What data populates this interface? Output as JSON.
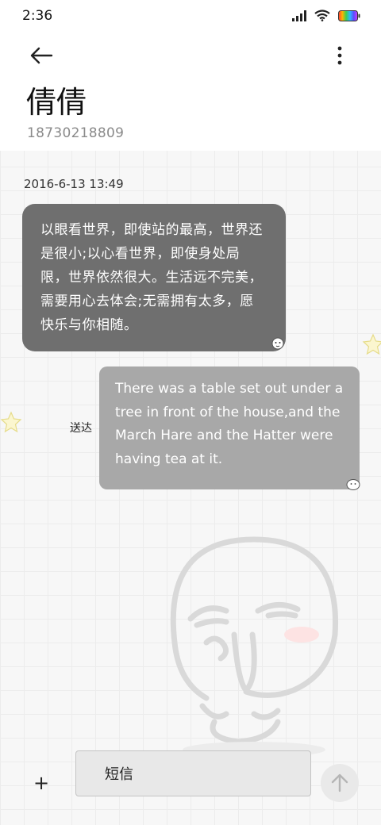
{
  "status_bar": {
    "time": "2:36",
    "icons": [
      "signal-icon",
      "wifi-icon",
      "battery-icon"
    ]
  },
  "header": {
    "back_icon": "arrow-left-icon",
    "more_icon": "vertical-dots-icon",
    "contact_name": "倩倩",
    "contact_number": "18730218809"
  },
  "conversation": {
    "timestamp": "2016-6-13 13:49",
    "messages": [
      {
        "direction": "incoming",
        "text": "以眼看世界，即使站的最高，世界还是很小;以心看世界，即使身处局限，世界依然很大。生活远不完美，需要用心去体会;无需拥有太多，愿快乐与你相随。"
      },
      {
        "direction": "outgoing",
        "status": "送达",
        "text": "There was a table set out under a tree in front of the house,and the March Hare and the Hatter were having tea at it."
      }
    ]
  },
  "composer": {
    "add_label": "+",
    "placeholder": "短信",
    "send_icon": "arrow-up-icon"
  },
  "colors": {
    "incoming_bubble": "#6f6f6f",
    "outgoing_bubble": "#a8a8a8",
    "background": "#f7f7f7"
  }
}
